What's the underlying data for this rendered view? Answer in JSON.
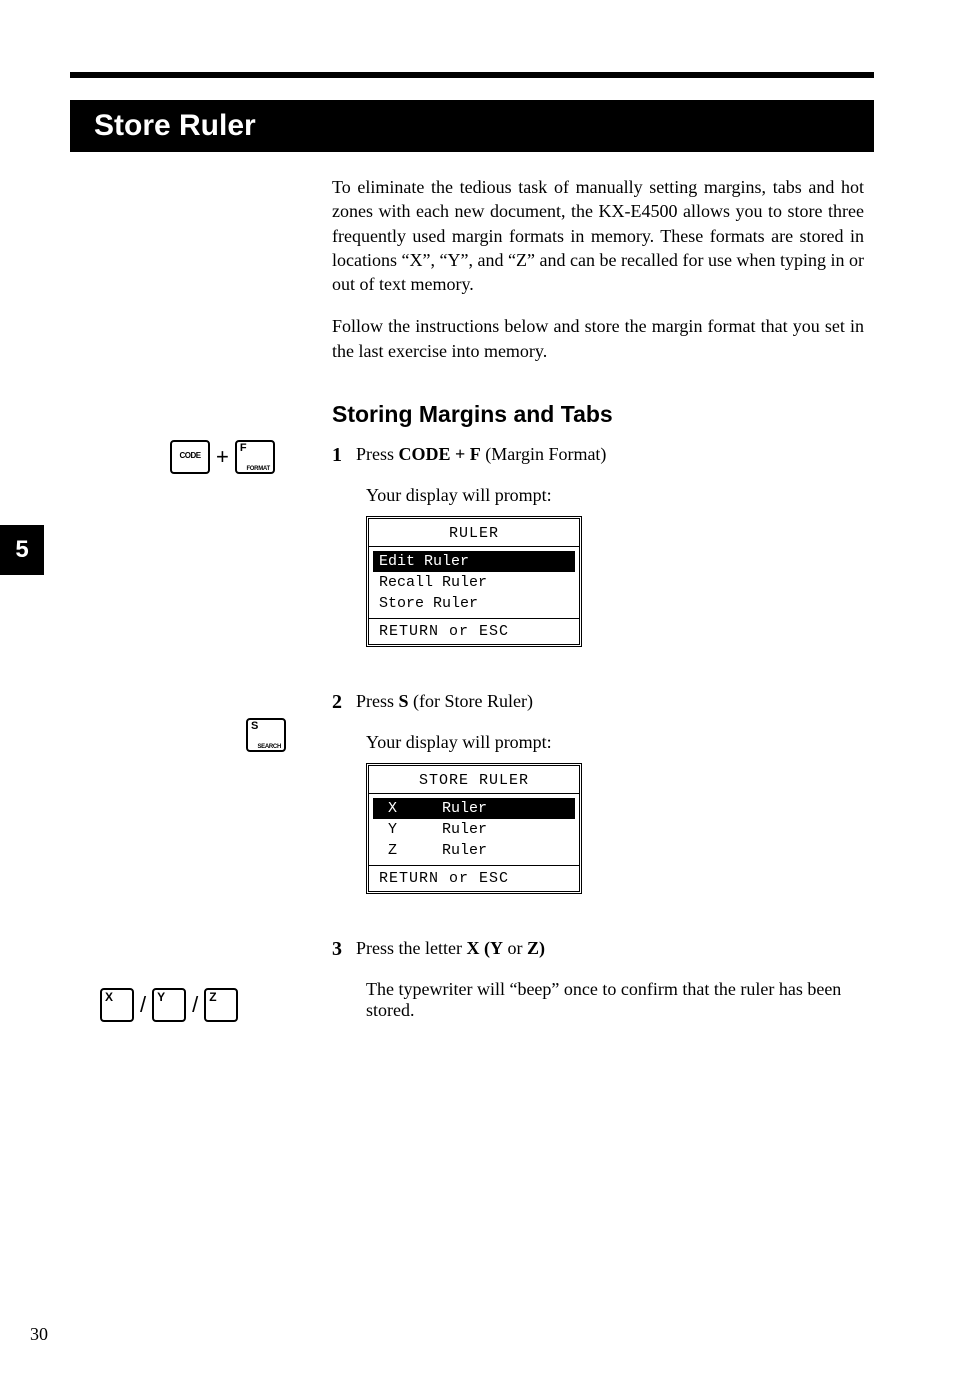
{
  "header": {
    "title": "Store Ruler"
  },
  "intro": {
    "p1": "To eliminate the tedious task of manually setting margins, tabs and hot zones with each new document, the KX-E4500 allows you to store three frequently used margin formats in memory. These formats are stored in locations “X”, “Y”, and “Z” and can be recalled for use when typing in or out of text memory.",
    "p2": "Follow the instructions below and store the margin format that you set in the last exercise into memory."
  },
  "subheading": "Storing Margins and Tabs",
  "steps": {
    "s1": {
      "num": "1",
      "prefix": "Press ",
      "bold": "CODE + F",
      "suffix": " (Margin Format)",
      "prompt": "Your display will prompt:"
    },
    "s2": {
      "num": "2",
      "prefix": "Press ",
      "bold": "S",
      "suffix": " (for Store Ruler)",
      "prompt": "Your display will prompt:"
    },
    "s3": {
      "num": "3",
      "prefix": "Press the letter ",
      "bold": "X (Y",
      "mid": " or ",
      "bold2": "Z)",
      "result": "The typewriter will “beep” once to confirm that the ruler has been stored."
    }
  },
  "display1": {
    "title": "RULER",
    "rows": [
      "Edit Ruler",
      "Recall Ruler",
      "Store Ruler"
    ],
    "selected": 0,
    "foot": "RETURN or ESC"
  },
  "display2": {
    "title": "STORE RULER",
    "rows": [
      " X     Ruler",
      " Y     Ruler",
      " Z     Ruler"
    ],
    "selected": 0,
    "foot": "RETURN or ESC"
  },
  "keys": {
    "code": "CODE",
    "f_top": "F",
    "f_bot": "FORMAT",
    "s_top": "S",
    "s_bot": "SEARCH",
    "x": "X",
    "y": "Y",
    "z": "Z",
    "plus": "+",
    "slash": "/"
  },
  "margin_tab": "5",
  "page_number": "30"
}
